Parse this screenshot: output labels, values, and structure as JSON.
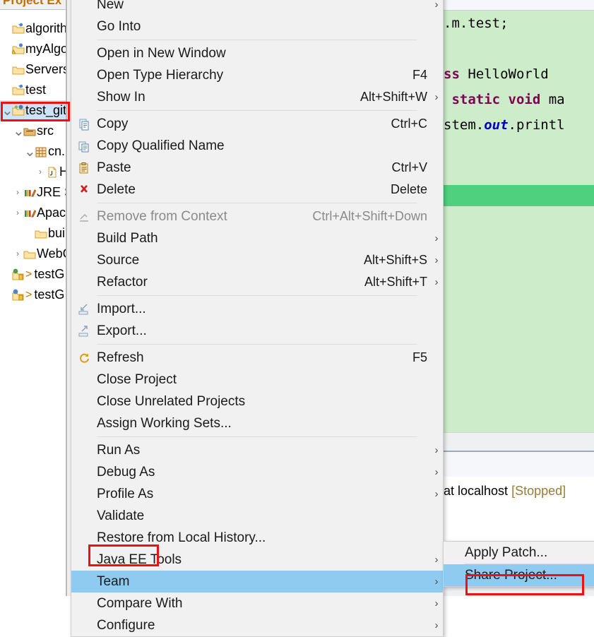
{
  "explorer": {
    "tab_label": "Project Ex",
    "items": [
      {
        "twisty": "",
        "icon": "project-folder-icon",
        "label": "algorith",
        "indent": 0,
        "selected": false,
        "prefix": ""
      },
      {
        "twisty": "",
        "icon": "project-warning-icon",
        "label": "myAlgo",
        "indent": 0,
        "selected": false,
        "prefix": ""
      },
      {
        "twisty": "",
        "icon": "folder-icon",
        "label": "Servers",
        "indent": 0,
        "selected": false,
        "prefix": ""
      },
      {
        "twisty": "",
        "icon": "project-folder-icon",
        "label": "test",
        "indent": 0,
        "selected": false,
        "prefix": ""
      },
      {
        "twisty": "v",
        "icon": "project-git-folder-icon",
        "label": "test_git",
        "indent": 0,
        "selected": true,
        "prefix": ""
      },
      {
        "twisty": "v",
        "icon": "source-folder-icon",
        "label": "src",
        "indent": 1,
        "selected": false,
        "prefix": ""
      },
      {
        "twisty": "v",
        "icon": "package-icon",
        "label": "cn.",
        "indent": 2,
        "selected": false,
        "prefix": ""
      },
      {
        "twisty": ">",
        "icon": "java-file-icon",
        "label": "H",
        "indent": 3,
        "selected": false,
        "prefix": ""
      },
      {
        "twisty": ">",
        "icon": "library-icon",
        "label": "JRE S",
        "indent": 1,
        "selected": false,
        "prefix": ""
      },
      {
        "twisty": ">",
        "icon": "library-icon",
        "label": "Apac",
        "indent": 1,
        "selected": false,
        "prefix": ""
      },
      {
        "twisty": "",
        "icon": "folder-icon",
        "label": "build",
        "indent": 2,
        "selected": false,
        "prefix": ""
      },
      {
        "twisty": ">",
        "icon": "folder-icon",
        "label": "WebC",
        "indent": 1,
        "selected": false,
        "prefix": ""
      },
      {
        "twisty": "",
        "icon": "web-project-icon",
        "label": "testG",
        "indent": 0,
        "selected": false,
        "prefix": ">"
      },
      {
        "twisty": "",
        "icon": "web-project-alt-icon",
        "label": "testG",
        "indent": 0,
        "selected": false,
        "prefix": ">"
      }
    ]
  },
  "context_menu": {
    "items": [
      {
        "label": "New",
        "shortcut": "",
        "arrow": true,
        "icon": "",
        "disabled": false,
        "highlighted": false
      },
      {
        "label": "Go Into",
        "shortcut": "",
        "arrow": false,
        "icon": "",
        "disabled": false,
        "highlighted": false
      },
      {
        "separator": true
      },
      {
        "label": "Open in New Window",
        "shortcut": "",
        "arrow": false,
        "icon": "",
        "disabled": false,
        "highlighted": false
      },
      {
        "label": "Open Type Hierarchy",
        "shortcut": "F4",
        "arrow": false,
        "icon": "",
        "disabled": false,
        "highlighted": false
      },
      {
        "label": "Show In",
        "shortcut": "Alt+Shift+W",
        "arrow": true,
        "icon": "",
        "disabled": false,
        "highlighted": false
      },
      {
        "separator": true
      },
      {
        "label": "Copy",
        "shortcut": "Ctrl+C",
        "arrow": false,
        "icon": "copy-icon",
        "disabled": false,
        "highlighted": false
      },
      {
        "label": "Copy Qualified Name",
        "shortcut": "",
        "arrow": false,
        "icon": "copy-qualified-icon",
        "disabled": false,
        "highlighted": false
      },
      {
        "label": "Paste",
        "shortcut": "Ctrl+V",
        "arrow": false,
        "icon": "paste-icon",
        "disabled": false,
        "highlighted": false
      },
      {
        "label": "Delete",
        "shortcut": "Delete",
        "arrow": false,
        "icon": "delete-icon",
        "disabled": false,
        "highlighted": false
      },
      {
        "separator": true
      },
      {
        "label": "Remove from Context",
        "shortcut": "Ctrl+Alt+Shift+Down",
        "arrow": false,
        "icon": "remove-context-icon",
        "disabled": true,
        "highlighted": false
      },
      {
        "label": "Build Path",
        "shortcut": "",
        "arrow": true,
        "icon": "",
        "disabled": false,
        "highlighted": false
      },
      {
        "label": "Source",
        "shortcut": "Alt+Shift+S",
        "arrow": true,
        "icon": "",
        "disabled": false,
        "highlighted": false
      },
      {
        "label": "Refactor",
        "shortcut": "Alt+Shift+T",
        "arrow": true,
        "icon": "",
        "disabled": false,
        "highlighted": false
      },
      {
        "separator": true
      },
      {
        "label": "Import...",
        "shortcut": "",
        "arrow": false,
        "icon": "import-icon",
        "disabled": false,
        "highlighted": false
      },
      {
        "label": "Export...",
        "shortcut": "",
        "arrow": false,
        "icon": "export-icon",
        "disabled": false,
        "highlighted": false
      },
      {
        "separator": true
      },
      {
        "label": "Refresh",
        "shortcut": "F5",
        "arrow": false,
        "icon": "refresh-icon",
        "disabled": false,
        "highlighted": false
      },
      {
        "label": "Close Project",
        "shortcut": "",
        "arrow": false,
        "icon": "",
        "disabled": false,
        "highlighted": false
      },
      {
        "label": "Close Unrelated Projects",
        "shortcut": "",
        "arrow": false,
        "icon": "",
        "disabled": false,
        "highlighted": false
      },
      {
        "label": "Assign Working Sets...",
        "shortcut": "",
        "arrow": false,
        "icon": "",
        "disabled": false,
        "highlighted": false
      },
      {
        "separator": true
      },
      {
        "label": "Run As",
        "shortcut": "",
        "arrow": true,
        "icon": "",
        "disabled": false,
        "highlighted": false
      },
      {
        "label": "Debug As",
        "shortcut": "",
        "arrow": true,
        "icon": "",
        "disabled": false,
        "highlighted": false
      },
      {
        "label": "Profile As",
        "shortcut": "",
        "arrow": true,
        "icon": "",
        "disabled": false,
        "highlighted": false
      },
      {
        "label": "Validate",
        "shortcut": "",
        "arrow": false,
        "icon": "",
        "disabled": false,
        "highlighted": false
      },
      {
        "label": "Restore from Local History...",
        "shortcut": "",
        "arrow": false,
        "icon": "",
        "disabled": false,
        "highlighted": false
      },
      {
        "label": "Java EE Tools",
        "shortcut": "",
        "arrow": true,
        "icon": "",
        "disabled": false,
        "highlighted": false
      },
      {
        "label": "Team",
        "shortcut": "",
        "arrow": true,
        "icon": "",
        "disabled": false,
        "highlighted": true
      },
      {
        "label": "Compare With",
        "shortcut": "",
        "arrow": true,
        "icon": "",
        "disabled": false,
        "highlighted": false
      },
      {
        "label": "Configure",
        "shortcut": "",
        "arrow": true,
        "icon": "",
        "disabled": false,
        "highlighted": false
      }
    ]
  },
  "submenu": {
    "items": [
      {
        "label": "Apply Patch...",
        "highlighted": false
      },
      {
        "label": "Share Project...",
        "highlighted": true
      }
    ]
  },
  "editor": {
    "lines": [
      [
        {
          "t": ".m.test;",
          "c": "plain"
        }
      ],
      [
        {
          "t": "",
          "c": "plain"
        }
      ],
      [
        {
          "t": "ss ",
          "c": "kw"
        },
        {
          "t": "HelloWorld ",
          "c": "plain"
        }
      ],
      [
        {
          "t": " static void ",
          "c": "kw"
        },
        {
          "t": "ma",
          "c": "plain"
        }
      ],
      [
        {
          "t": "stem.",
          "c": "plain"
        },
        {
          "t": "out",
          "c": "fld"
        },
        {
          "t": ".printl",
          "c": "plain"
        }
      ]
    ]
  },
  "servers": {
    "row_text": " at localhost ",
    "status": "[Stopped]"
  },
  "colors": {
    "menu_bg": "#f1f1f1",
    "menu_highlight": "#8fcbf0",
    "tree_selection": "#cde3f7",
    "red_annotation": "#ee1111",
    "editor_bg": "#cdecca",
    "editor_marker": "#4fd07f",
    "keyword": "#7f0055",
    "field": "#0000c0",
    "tab_label": "#c07000",
    "status_stopped": "#9a7b3a"
  }
}
